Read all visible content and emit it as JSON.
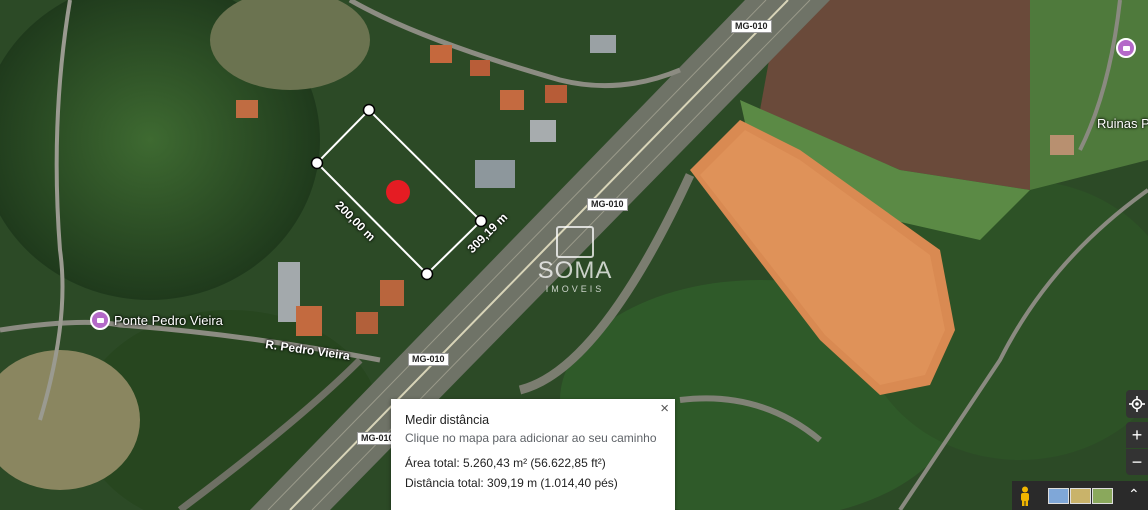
{
  "map": {
    "road_labels": [
      "MG-010",
      "MG-010",
      "MG-010",
      "MG-010"
    ],
    "places": [
      {
        "name": "Ponte Pedro Vieira",
        "icon": "camera-pin-icon"
      },
      {
        "name": "Ruinas Ponte",
        "icon": "camera-pin-icon"
      }
    ],
    "street_name": "R. Pedro Vieira",
    "segment_labels": [
      "200,00 m",
      "309,19 m"
    ],
    "watermark": {
      "name": "SOMA",
      "sub": "IMOVEIS"
    },
    "colors": {
      "marker": "#e51c23",
      "measure_line": "#ffffff",
      "pin": "#b469c8"
    }
  },
  "panel": {
    "title": "Medir distância",
    "hint": "Clique no mapa para adicionar ao seu caminho",
    "area": "Área total: 5.260,43 m² (56.622,85 ft²)",
    "distance": "Distância total: 309,19 m (1.014,40 pés)",
    "close": "×"
  },
  "controls": {
    "location": "my-location-icon",
    "zoom_in": "+",
    "zoom_out": "−",
    "pegman": "pegman-icon",
    "expand": "chevron-up-icon"
  }
}
